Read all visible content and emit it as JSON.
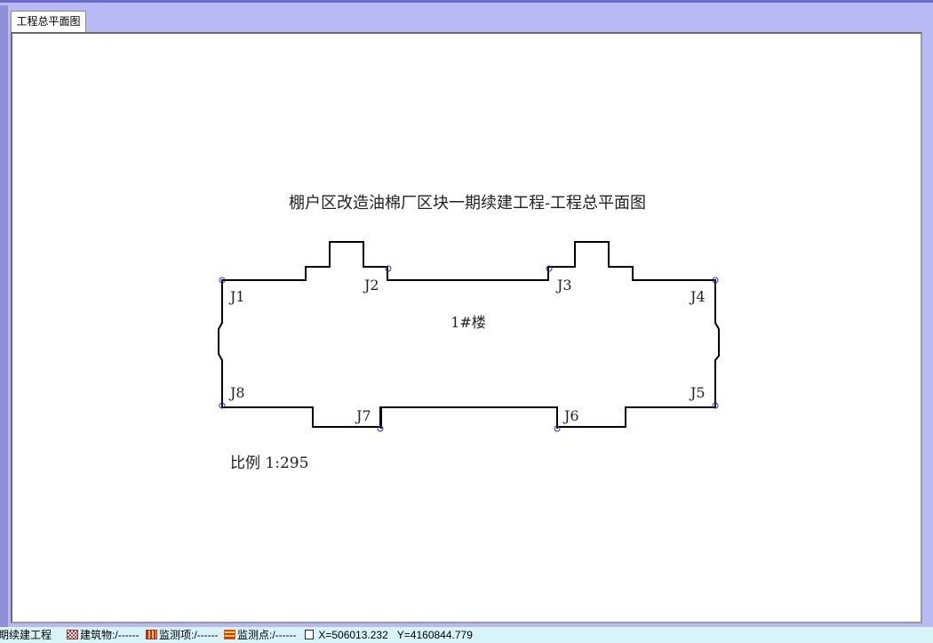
{
  "tab": {
    "label": "工程总平面图"
  },
  "drawing": {
    "title": "棚户区改造油棉厂区块一期续建工程-工程总平面图",
    "building_label": "1#楼",
    "scale_text": "比例 1:295",
    "points": [
      "J1",
      "J2",
      "J3",
      "J4",
      "J5",
      "J6",
      "J7",
      "J8"
    ]
  },
  "status": {
    "project": "期续建工程",
    "building": "建筑物:/------",
    "monitor_item": "监测项:/------",
    "monitor_point": "监测点:/------",
    "x": "X=506013.232",
    "y": "Y=4160844.779"
  },
  "colors": {
    "frame": "#b9b9f5",
    "outline": "#000000",
    "point": "#2a2ad8",
    "status_bg": "#d8f4f8"
  },
  "icons": [
    "building-legend-icon",
    "monitor-item-legend-icon",
    "monitor-point-legend-icon",
    "coordinate-icon"
  ]
}
